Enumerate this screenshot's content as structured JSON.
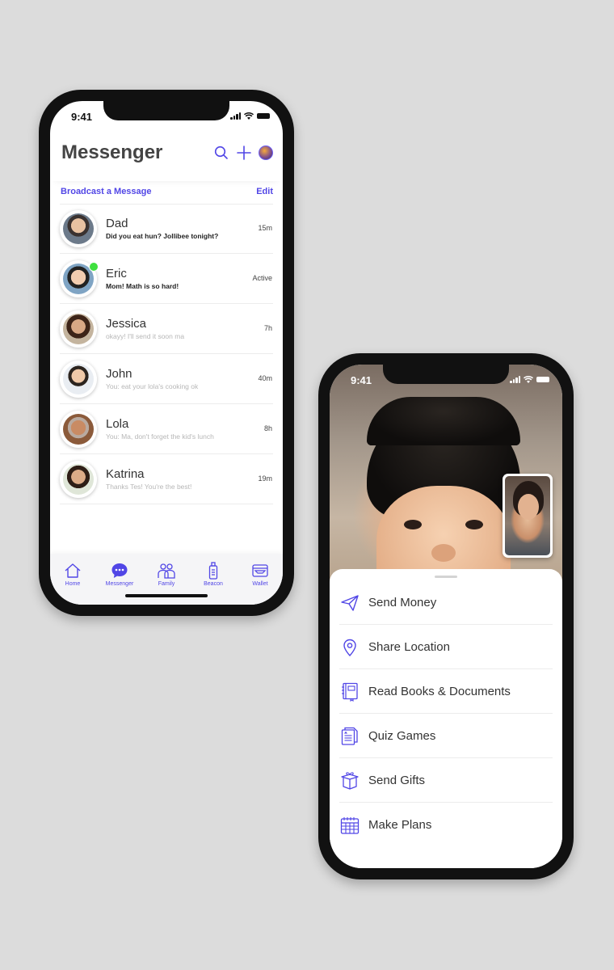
{
  "messenger_screen": {
    "status_time": "9:41",
    "title": "Messenger",
    "header_icons": [
      "search-icon",
      "plus-icon",
      "profile-avatar"
    ],
    "broadcast_label": "Broadcast a Message",
    "edit_label": "Edit",
    "conversations": [
      {
        "name": "Dad",
        "preview": "Did you eat hun? Jollibee tonight?",
        "time": "15m",
        "unread": true,
        "online": false
      },
      {
        "name": "Eric",
        "preview": "Mom! Math is so hard!",
        "time": "Active",
        "unread": true,
        "online": true
      },
      {
        "name": "Jessica",
        "preview": "okayy! I'll send it soon ma",
        "time": "7h",
        "unread": false,
        "online": false
      },
      {
        "name": "John",
        "preview": "You: eat your lola's cooking ok",
        "time": "40m",
        "unread": false,
        "online": false
      },
      {
        "name": "Lola",
        "preview": "You: Ma, don't forget the kid's lunch",
        "time": "8h",
        "unread": false,
        "online": false
      },
      {
        "name": "Katrina",
        "preview": "Thanks Tes! You're the best!",
        "time": "19m",
        "unread": false,
        "online": false
      }
    ],
    "nav": [
      {
        "label": "Home",
        "icon": "home-icon"
      },
      {
        "label": "Messenger",
        "icon": "chat-bubble-icon"
      },
      {
        "label": "Family",
        "icon": "family-icon"
      },
      {
        "label": "Beacon",
        "icon": "beacon-icon"
      },
      {
        "label": "Wallet",
        "icon": "wallet-icon"
      }
    ]
  },
  "call_screen": {
    "status_time": "9:41",
    "actions": [
      {
        "label": "Send Money",
        "icon": "paper-plane-icon"
      },
      {
        "label": "Share Location",
        "icon": "location-pin-icon"
      },
      {
        "label": "Read Books & Documents",
        "icon": "book-icon"
      },
      {
        "label": "Quiz Games",
        "icon": "quiz-document-icon"
      },
      {
        "label": "Send Gifts",
        "icon": "gift-icon"
      },
      {
        "label": "Make Plans",
        "icon": "calendar-icon"
      }
    ]
  },
  "colors": {
    "accent": "#5146e6",
    "online": "#3fe03f",
    "background": "#dcdcdc",
    "phone_frame": "#111111"
  }
}
